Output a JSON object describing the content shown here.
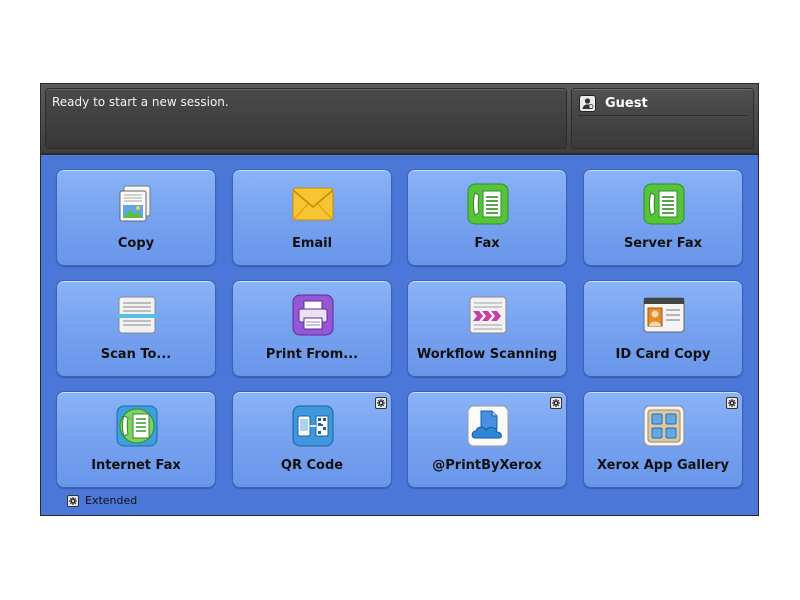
{
  "header": {
    "status_message": "Ready to start a new session.",
    "user_label": "Guest"
  },
  "apps": [
    {
      "label": "Copy",
      "icon": "copy-icon",
      "extended": false
    },
    {
      "label": "Email",
      "icon": "email-icon",
      "extended": false
    },
    {
      "label": "Fax",
      "icon": "fax-icon",
      "extended": false
    },
    {
      "label": "Server Fax",
      "icon": "server-fax-icon",
      "extended": false
    },
    {
      "label": "Scan To...",
      "icon": "scan-to-icon",
      "extended": false
    },
    {
      "label": "Print From...",
      "icon": "print-from-icon",
      "extended": false
    },
    {
      "label": "Workflow Scanning",
      "icon": "workflow-scanning-icon",
      "extended": false
    },
    {
      "label": "ID Card Copy",
      "icon": "id-card-copy-icon",
      "extended": false
    },
    {
      "label": "Internet Fax",
      "icon": "internet-fax-icon",
      "extended": false
    },
    {
      "label": "QR Code",
      "icon": "qr-code-icon",
      "extended": true
    },
    {
      "label": "@PrintByXerox",
      "icon": "cloud-print-icon",
      "extended": true
    },
    {
      "label": "Xerox App Gallery",
      "icon": "app-gallery-icon",
      "extended": true
    }
  ],
  "legend": {
    "label": "Extended",
    "icon": "extended-app-icon"
  },
  "colors": {
    "background": "#4a77d8",
    "tile": "#7aa5f1",
    "header": "#4a4a4a"
  }
}
